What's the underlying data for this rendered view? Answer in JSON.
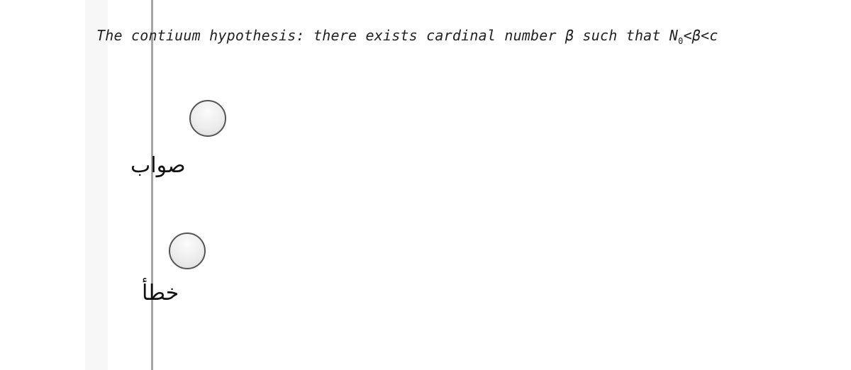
{
  "question": {
    "text": "The contiuum hypothesis: there exists cardinal number β such that N",
    "subscript": "0",
    "suffix": "<β<c"
  },
  "options": [
    {
      "label": "صواب",
      "selected": false
    },
    {
      "label": "خطأ",
      "selected": false
    }
  ]
}
